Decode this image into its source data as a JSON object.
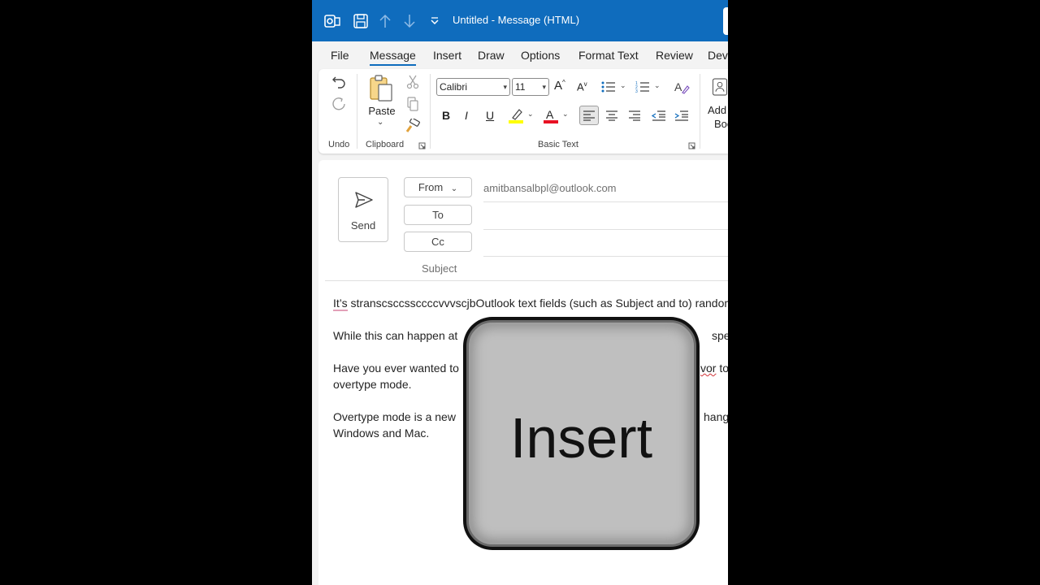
{
  "titlebar": {
    "title": "Untitled  -  Message (HTML)",
    "icons": [
      "outlook-icon",
      "save-icon",
      "previous-item-icon",
      "next-item-icon",
      "customize-quick-access-icon"
    ]
  },
  "menu": {
    "tabs": [
      "File",
      "Message",
      "Insert",
      "Draw",
      "Options",
      "Format Text",
      "Review",
      "Deve"
    ],
    "active": "Message"
  },
  "ribbon": {
    "undo_group_label": "Undo",
    "paste_label": "Paste",
    "clipboard_group_label": "Clipboard",
    "font_name": "Calibri",
    "font_size": "11",
    "bold": "B",
    "italic": "I",
    "underline": "U",
    "basic_text_group_label": "Basic Text",
    "address_book_label_1": "Add",
    "address_book_label_2": "Boo",
    "highlight_color": "#ffff00",
    "font_color": "#e81123"
  },
  "compose": {
    "send_label": "Send",
    "from_label": "From",
    "from_address": "amitbansalbpl@outlook.com",
    "to_label": "To",
    "cc_label": "Cc",
    "subject_label": "Subject",
    "body": {
      "p1_prefix": "It’s",
      "p1_rest": " stranscsccssccccvvvscjbOutlook text fields (such as Subject and to) random",
      "p2": "While this can happen at",
      "p2_end": "speci",
      "p3_start": "Have you ever wanted to",
      "p3_end_word": "vor",
      "p3_end_rest": " to",
      "p3_line2": "overtype mode.",
      "p4_start": "Overtype mode is a new",
      "p4_end": "hange",
      "p4_line2": "Windows and Mac."
    }
  },
  "overlay": {
    "key_label": "Insert"
  },
  "colors": {
    "titlebar": "#0f6cbd",
    "accent": "#0f6cbd"
  }
}
